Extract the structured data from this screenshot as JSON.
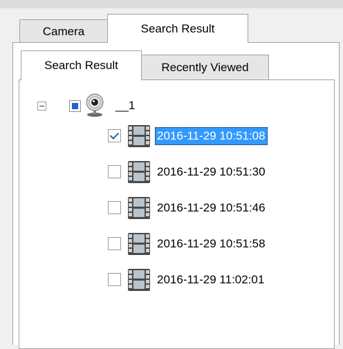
{
  "top_tabs": [
    {
      "label": "Camera",
      "active": false
    },
    {
      "label": "Search Result",
      "active": true
    }
  ],
  "inner_tabs": [
    {
      "label": "Search Result",
      "active": true
    },
    {
      "label": "Recently Viewed",
      "active": false
    }
  ],
  "tree": {
    "camera_node": {
      "label": "__1",
      "expanded": true,
      "check_state": "partial",
      "icon": "webcam-icon"
    },
    "recordings": [
      {
        "timestamp": "2016-11-29 10:51:08",
        "checked": true,
        "selected": true,
        "icon": "film-icon"
      },
      {
        "timestamp": "2016-11-29 10:51:30",
        "checked": false,
        "selected": false,
        "icon": "film-icon"
      },
      {
        "timestamp": "2016-11-29 10:51:46",
        "checked": false,
        "selected": false,
        "icon": "film-icon"
      },
      {
        "timestamp": "2016-11-29 10:51:58",
        "checked": false,
        "selected": false,
        "icon": "film-icon"
      },
      {
        "timestamp": "2016-11-29 11:02:01",
        "checked": false,
        "selected": false,
        "icon": "film-icon"
      }
    ]
  },
  "colors": {
    "selection_bg": "#3399ff",
    "selection_fg": "#ffffff",
    "partial_check": "#1d63d6",
    "panel_bg": "#ffffff",
    "inactive_tab_bg": "#e6e6e6",
    "window_bg": "#f0f0f0"
  }
}
